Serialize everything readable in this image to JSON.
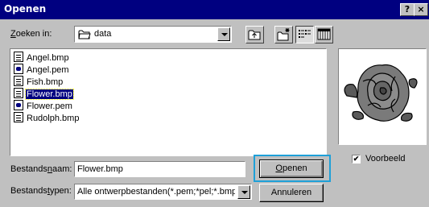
{
  "window": {
    "title": "Openen",
    "help_button": "?",
    "close_button": "×"
  },
  "lookin": {
    "label_pre": "",
    "label_ul": "Z",
    "label_post": "oeken in:",
    "value": "data"
  },
  "toolbar": {
    "icons": [
      "up-folder-icon",
      "new-folder-icon",
      "list-view-icon",
      "details-view-icon"
    ]
  },
  "files": [
    {
      "name": "Angel.bmp",
      "type": "bmp"
    },
    {
      "name": "Angel.pem",
      "type": "pem"
    },
    {
      "name": "Fish.bmp",
      "type": "bmp"
    },
    {
      "name": "Flower.bmp",
      "type": "bmp",
      "selected": true
    },
    {
      "name": "Flower.pem",
      "type": "pem"
    },
    {
      "name": "Rudolph.bmp",
      "type": "bmp"
    }
  ],
  "preview": {
    "checkbox_label": "Voorbeeld",
    "checked": true,
    "check_mark": "✔"
  },
  "filename": {
    "label_pre": "Bestands",
    "label_ul": "n",
    "label_post": "aam:",
    "value": "Flower.bmp"
  },
  "filetype": {
    "label_pre": "Bestands",
    "label_ul": "t",
    "label_post": "ypen:",
    "value": "Alle ontwerpbestanden(*.pem;*pel;*.bmp;*.pc"
  },
  "buttons": {
    "open_ul": "O",
    "open_post": "penen",
    "cancel": "Annuleren"
  }
}
